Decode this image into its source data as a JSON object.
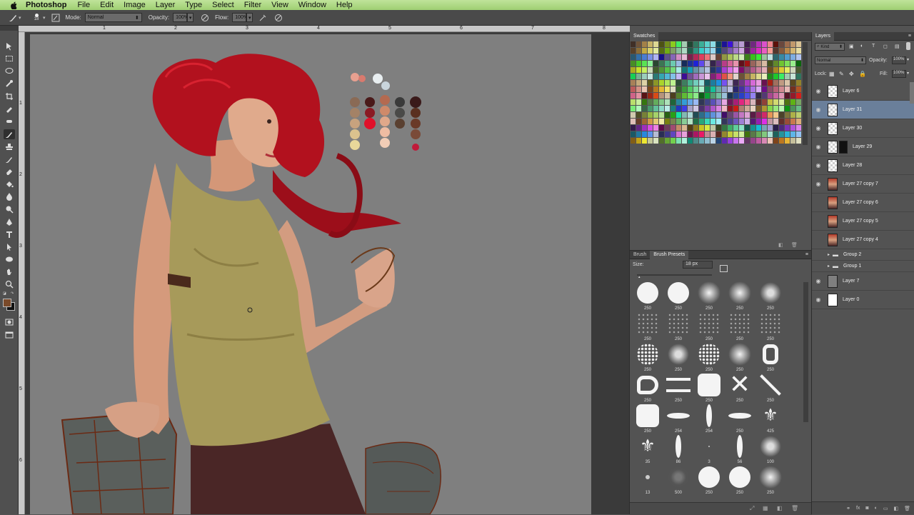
{
  "menubar": {
    "app_name": "Photoshop",
    "items": [
      "File",
      "Edit",
      "Image",
      "Layer",
      "Type",
      "Select",
      "Filter",
      "View",
      "Window",
      "Help"
    ]
  },
  "options_bar": {
    "brush_size": "18",
    "mode_label": "Mode:",
    "mode_value": "Normal",
    "opacity_label": "Opacity:",
    "opacity_value": "100%",
    "flow_label": "Flow:",
    "flow_value": "100%"
  },
  "ruler": {
    "top_marks": [
      "1",
      "2",
      "3",
      "4",
      "5",
      "6",
      "7",
      "8"
    ],
    "left_marks": [
      "1",
      "2",
      "3",
      "4",
      "5",
      "6"
    ]
  },
  "colors": {
    "foreground": "#7a4a2a",
    "background": "#111111",
    "accent_selection": "#6a7f9a"
  },
  "swatches_panel": {
    "tab": "Swatches"
  },
  "brush_panel": {
    "tabs": [
      "Brush",
      "Brush Presets"
    ],
    "size_label": "Size:",
    "size_value": "18 px",
    "presets": [
      {
        "label": "250",
        "shape": "hard-round"
      },
      {
        "label": "250",
        "shape": "hard-round"
      },
      {
        "label": "250",
        "shape": "soft-round"
      },
      {
        "label": "250",
        "shape": "soft-round"
      },
      {
        "label": "250",
        "shape": "texture"
      },
      {
        "label": "250",
        "shape": "speckle"
      },
      {
        "label": "250",
        "shape": "speckle"
      },
      {
        "label": "250",
        "shape": "speckle"
      },
      {
        "label": "250",
        "shape": "speckle"
      },
      {
        "label": "250",
        "shape": "speckle"
      },
      {
        "label": "250",
        "shape": "spatter"
      },
      {
        "label": "250",
        "shape": "texture"
      },
      {
        "label": "250",
        "shape": "spatter"
      },
      {
        "label": "250",
        "shape": "soft-round"
      },
      {
        "label": "250",
        "shape": "ring"
      },
      {
        "label": "250",
        "shape": "triangle"
      },
      {
        "label": "250",
        "shape": "lines"
      },
      {
        "label": "250",
        "shape": "square"
      },
      {
        "label": "250",
        "shape": "cross"
      },
      {
        "label": "250",
        "shape": "diagonal"
      },
      {
        "label": "250",
        "shape": "square"
      },
      {
        "label": "254",
        "shape": "ellipse"
      },
      {
        "label": "254",
        "shape": "ellipse-v"
      },
      {
        "label": "250",
        "shape": "ellipse"
      },
      {
        "label": "425",
        "shape": "leaf"
      },
      {
        "label": "35",
        "shape": "leaf"
      },
      {
        "label": "86",
        "shape": "ellipse-v"
      },
      {
        "label": "3",
        "shape": "dot"
      },
      {
        "label": "56",
        "shape": "ellipse-v"
      },
      {
        "label": "100",
        "shape": "texture"
      },
      {
        "label": "13",
        "shape": "dot-big"
      },
      {
        "label": "500",
        "shape": "texture-dark"
      },
      {
        "label": "250",
        "shape": "hard-round"
      },
      {
        "label": "250",
        "shape": "hard-round"
      },
      {
        "label": "250",
        "shape": "soft-round"
      }
    ]
  },
  "layers_panel": {
    "tab": "Layers",
    "filter_kind": "Kind",
    "blend_mode": "Normal",
    "opacity_label": "Opacity:",
    "opacity_value": "100%",
    "lock_label": "Lock:",
    "fill_label": "Fill:",
    "fill_value": "100%",
    "layers": [
      {
        "name": "Layer 6",
        "type": "layer",
        "selected": false,
        "visible": true
      },
      {
        "name": "Layer 31",
        "type": "layer",
        "selected": true,
        "visible": true
      },
      {
        "name": "Layer 30",
        "type": "layer",
        "selected": false,
        "visible": true
      },
      {
        "name": "Layer 29",
        "type": "layer-mask",
        "selected": false,
        "visible": true
      },
      {
        "name": "Layer 28",
        "type": "layer",
        "selected": false,
        "visible": true
      },
      {
        "name": "Layer 27 copy 7",
        "type": "layer-image",
        "selected": false,
        "visible": true
      },
      {
        "name": "Layer 27 copy 6",
        "type": "layer-image",
        "selected": false,
        "visible": false
      },
      {
        "name": "Layer 27 copy 5",
        "type": "layer-image",
        "selected": false,
        "visible": false
      },
      {
        "name": "Layer 27 copy 4",
        "type": "layer-image",
        "selected": false,
        "visible": false
      },
      {
        "name": "Group 2",
        "type": "group",
        "selected": false,
        "visible": false
      },
      {
        "name": "Group 1",
        "type": "group",
        "selected": false,
        "visible": false
      },
      {
        "name": "Layer 7",
        "type": "layer-gray",
        "selected": false,
        "visible": true
      },
      {
        "name": "Layer 0",
        "type": "layer-white",
        "selected": false,
        "visible": true
      }
    ]
  }
}
